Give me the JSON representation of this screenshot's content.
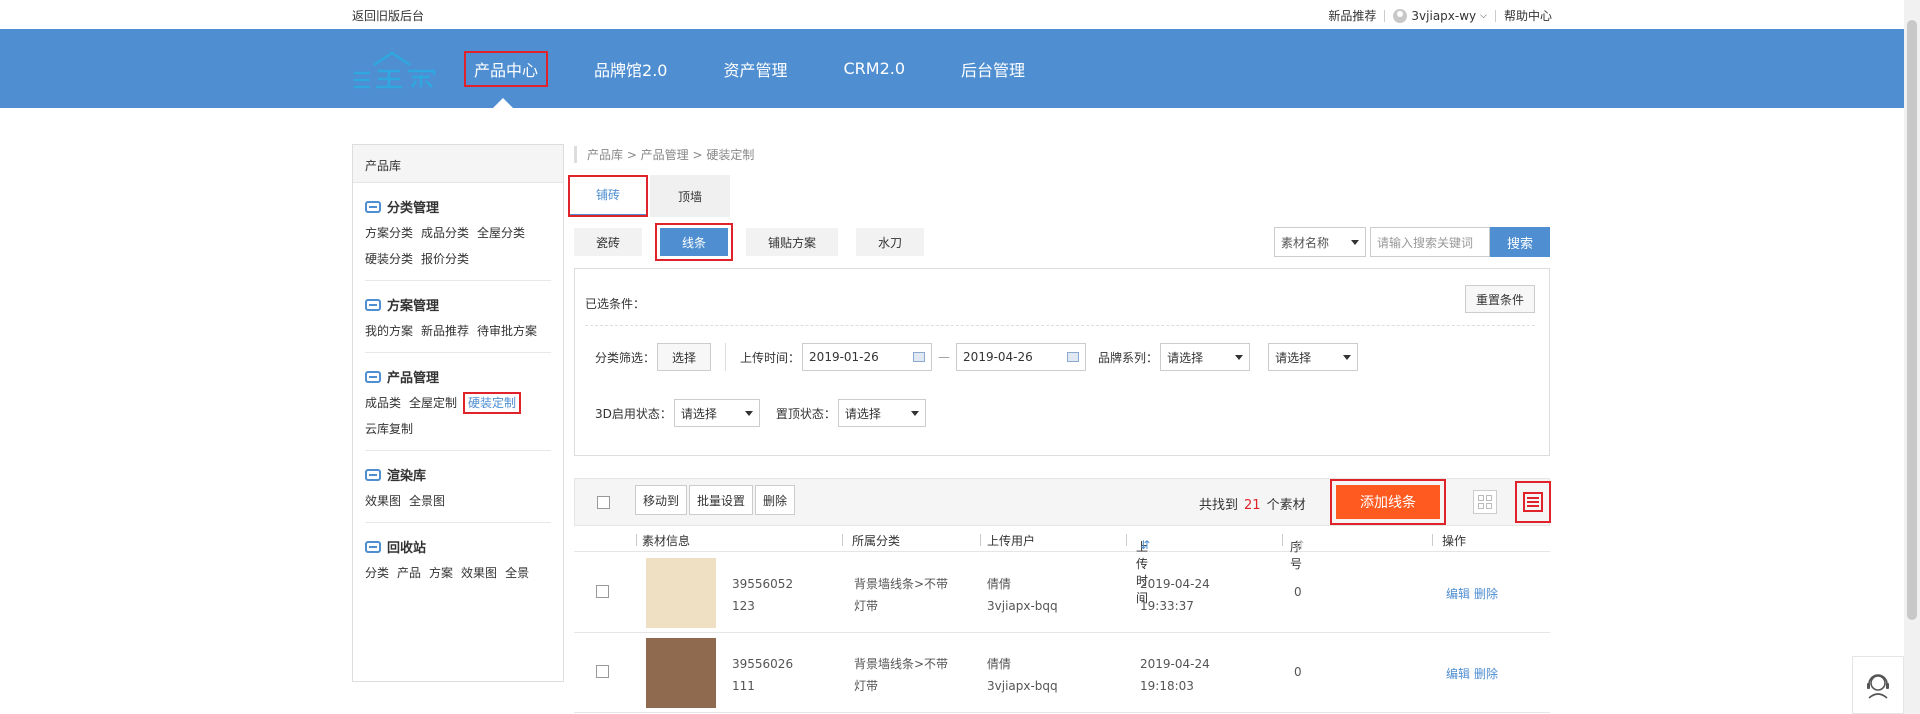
{
  "topbar": {
    "back_label": "返回旧版后台",
    "new_products": "新品推荐",
    "username": "3vjiapx-wy",
    "help": "帮助中心"
  },
  "header": {
    "logo_text": "三维家",
    "nav": [
      {
        "label": "产品中心",
        "active": true
      },
      {
        "label": "品牌馆2.0"
      },
      {
        "label": "资产管理"
      },
      {
        "label": "CRM2.0"
      },
      {
        "label": "后台管理"
      }
    ]
  },
  "sidebar": {
    "title": "产品库",
    "groups": [
      {
        "title": "分类管理",
        "links": [
          "方案分类",
          "成品分类",
          "全屋分类",
          "硬装分类",
          "报价分类"
        ]
      },
      {
        "title": "方案管理",
        "links": [
          "我的方案",
          "新品推荐",
          "待审批方案"
        ]
      },
      {
        "title": "产品管理",
        "links": [
          "成品类",
          "全屋定制",
          "硬装定制",
          "云库复制"
        ]
      },
      {
        "title": "渲染库",
        "links": [
          "效果图",
          "全景图"
        ]
      },
      {
        "title": "回收站",
        "links": [
          "分类",
          "产品",
          "方案",
          "效果图",
          "全景"
        ]
      }
    ]
  },
  "breadcrumb": "产品库 > 产品管理 > 硬装定制",
  "tabs": [
    "铺砖",
    "顶墙"
  ],
  "subtabs": [
    "瓷砖",
    "线条",
    "铺贴方案",
    "水刀"
  ],
  "search": {
    "field_select": "素材名称",
    "placeholder": "请输入搜索关键词",
    "button": "搜索"
  },
  "filter": {
    "selected_label": "已选条件：",
    "reset": "重置条件",
    "category_label": "分类筛选：",
    "choose": "选择",
    "upload_time_label": "上传时间：",
    "date_from": "2019-01-26",
    "date_sep": "—",
    "date_to": "2019-04-26",
    "brand_label": "品牌系列：",
    "brand_value": "请选择",
    "brand_value2": "请选择",
    "status3d_label": "3D启用状态：",
    "status3d_value": "请选择",
    "top_label": "置顶状态：",
    "top_value": "请选择"
  },
  "toolbar": {
    "move": "移动到",
    "batch": "批量设置",
    "delete": "删除",
    "found_prefix": "共找到",
    "found_count": "21",
    "found_suffix": "个素材",
    "add": "添加线条"
  },
  "table": {
    "headers": {
      "info": "素材信息",
      "category": "所属分类",
      "user": "上传用户",
      "time": "上传时间",
      "seq": "序号",
      "ops": "操作"
    },
    "rows": [
      {
        "id1": "39556052",
        "id2": "123",
        "cat1": "背景墙线条>不带",
        "cat2": "灯带",
        "user1": "倩倩",
        "user2": "3vjiapx-bqq",
        "date": "2019-04-24",
        "clock": "19:33:37",
        "seq": "0",
        "edit": "编辑",
        "del": "删除",
        "swatch": "#efe0c4"
      },
      {
        "id1": "39556026",
        "id2": "111",
        "cat1": "背景墙线条>不带",
        "cat2": "灯带",
        "user1": "倩倩",
        "user2": "3vjiapx-bqq",
        "date": "2019-04-24",
        "clock": "19:18:03",
        "seq": "0",
        "edit": "编辑",
        "del": "删除",
        "swatch": "#8f6a4e"
      }
    ]
  },
  "colors": {
    "brand": "#4e8ed1",
    "accent": "#ff5a1f",
    "highlight": "#e0232a"
  }
}
